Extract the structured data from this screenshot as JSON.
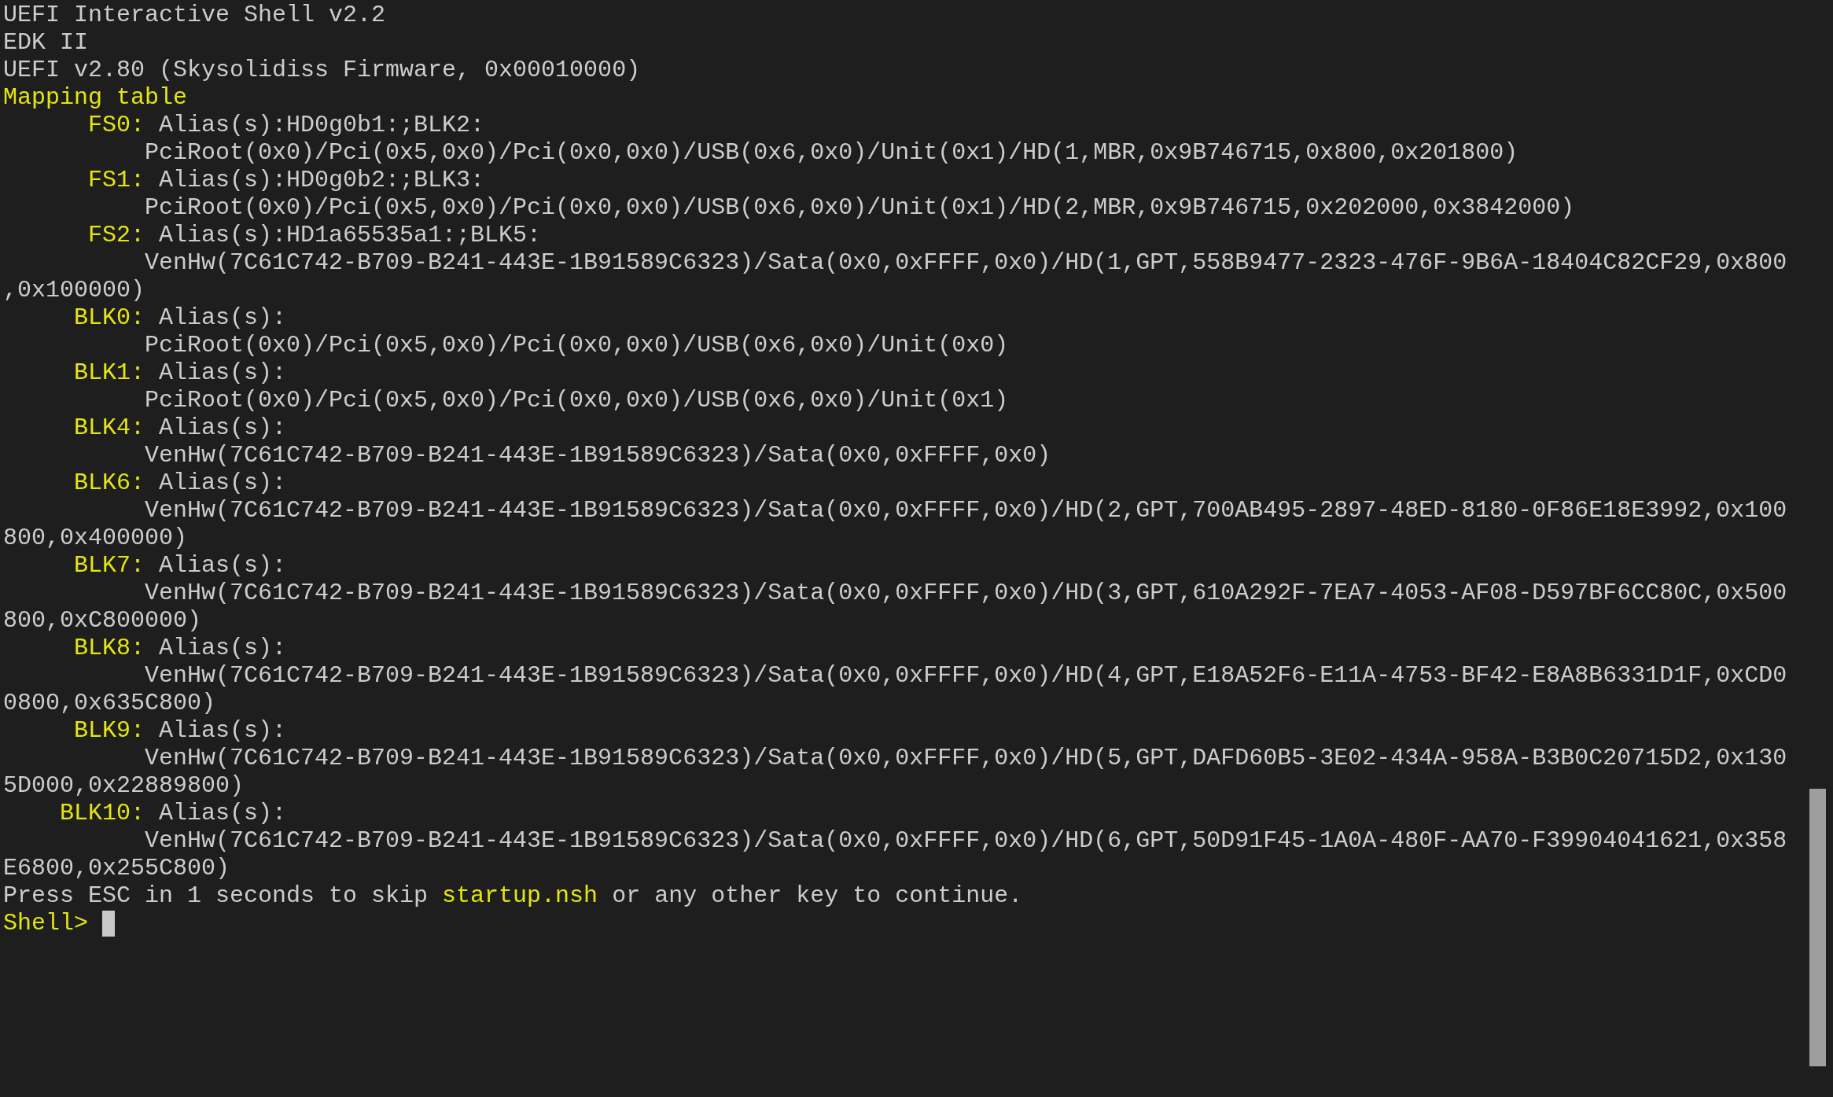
{
  "header_lines": [
    "UEFI Interactive Shell v2.2",
    "EDK II",
    "UEFI v2.80 (Skysolidiss Firmware, 0x00010000)"
  ],
  "mapping_title": "Mapping table",
  "mappings": [
    {
      "name": "FS0:",
      "alias": "Alias(s):HD0g0b1:;BLK2:",
      "path": "PciRoot(0x0)/Pci(0x5,0x0)/Pci(0x0,0x0)/USB(0x6,0x0)/Unit(0x1)/HD(1,MBR,0x9B746715,0x800,0x201800)"
    },
    {
      "name": "FS1:",
      "alias": "Alias(s):HD0g0b2:;BLK3:",
      "path": "PciRoot(0x0)/Pci(0x5,0x0)/Pci(0x0,0x0)/USB(0x6,0x0)/Unit(0x1)/HD(2,MBR,0x9B746715,0x202000,0x3842000)"
    },
    {
      "name": "FS2:",
      "alias": "Alias(s):HD1a65535a1:;BLK5:",
      "path": "VenHw(7C61C742-B709-B241-443E-1B91589C6323)/Sata(0x0,0xFFFF,0x0)/HD(1,GPT,558B9477-2323-476F-9B6A-18404C82CF29,0x800,0x100000)"
    },
    {
      "name": "BLK0:",
      "alias": "Alias(s):",
      "path": "PciRoot(0x0)/Pci(0x5,0x0)/Pci(0x0,0x0)/USB(0x6,0x0)/Unit(0x0)"
    },
    {
      "name": "BLK1:",
      "alias": "Alias(s):",
      "path": "PciRoot(0x0)/Pci(0x5,0x0)/Pci(0x0,0x0)/USB(0x6,0x0)/Unit(0x1)"
    },
    {
      "name": "BLK4:",
      "alias": "Alias(s):",
      "path": "VenHw(7C61C742-B709-B241-443E-1B91589C6323)/Sata(0x0,0xFFFF,0x0)"
    },
    {
      "name": "BLK6:",
      "alias": "Alias(s):",
      "path": "VenHw(7C61C742-B709-B241-443E-1B91589C6323)/Sata(0x0,0xFFFF,0x0)/HD(2,GPT,700AB495-2897-48ED-8180-0F86E18E3992,0x100800,0x400000)"
    },
    {
      "name": "BLK7:",
      "alias": "Alias(s):",
      "path": "VenHw(7C61C742-B709-B241-443E-1B91589C6323)/Sata(0x0,0xFFFF,0x0)/HD(3,GPT,610A292F-7EA7-4053-AF08-D597BF6CC80C,0x500800,0xC800000)"
    },
    {
      "name": "BLK8:",
      "alias": "Alias(s):",
      "path": "VenHw(7C61C742-B709-B241-443E-1B91589C6323)/Sata(0x0,0xFFFF,0x0)/HD(4,GPT,E18A52F6-E11A-4753-BF42-E8A8B6331D1F,0xCD00800,0x635C800)"
    },
    {
      "name": "BLK9:",
      "alias": "Alias(s):",
      "path": "VenHw(7C61C742-B709-B241-443E-1B91589C6323)/Sata(0x0,0xFFFF,0x0)/HD(5,GPT,DAFD60B5-3E02-434A-958A-B3B0C20715D2,0x1305D000,0x22889800)"
    },
    {
      "name": "BLK10:",
      "alias": "Alias(s):",
      "path": "VenHw(7C61C742-B709-B241-443E-1B91589C6323)/Sata(0x0,0xFFFF,0x0)/HD(6,GPT,50D91F45-1A0A-480F-AA70-F39904041621,0x358E6800,0x255C800)"
    }
  ],
  "startup_message": {
    "before": "Press ESC in 1 seconds to skip",
    "highlight": "startup.nsh",
    "after": "or any other key to continue."
  },
  "prompt": "Shell>"
}
